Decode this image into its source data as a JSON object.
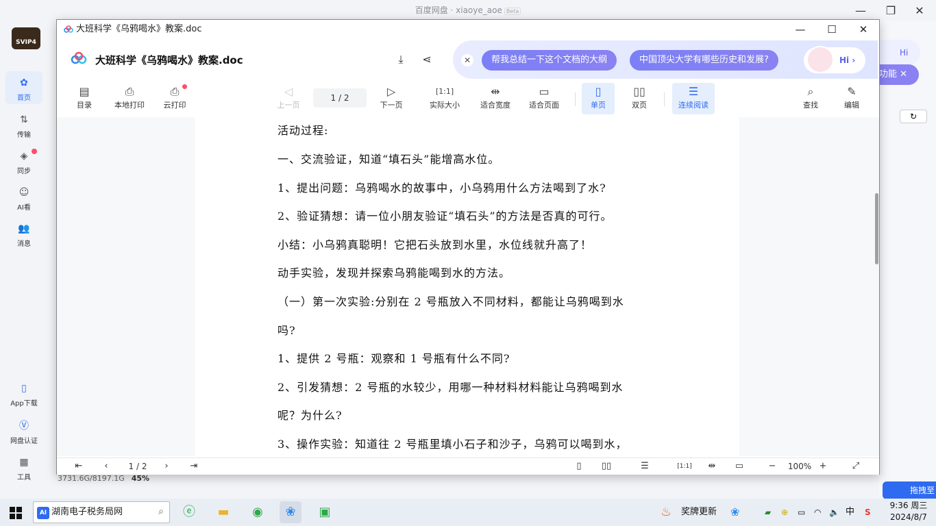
{
  "background": {
    "title": "百度网盘 · xiaoye_aoe",
    "beta": "Beta",
    "avatar_text": "SVIP4",
    "sidebar": [
      {
        "label": "首页",
        "icon": "home-icon"
      },
      {
        "label": "传输",
        "icon": "transfer-icon"
      },
      {
        "label": "同步",
        "icon": "sync-icon"
      },
      {
        "label": "AI看",
        "icon": "ai-view-icon"
      },
      {
        "label": "消息",
        "icon": "message-icon"
      },
      {
        "label": "App下载",
        "icon": "phone-icon"
      },
      {
        "label": "网盘认证",
        "icon": "verify-icon"
      },
      {
        "label": "工具",
        "icon": "tools-icon"
      }
    ],
    "storage_used": "3731.6G/8197.1G",
    "storage_percent": "45%",
    "right_feature": "功能",
    "right_hi": "Hi",
    "drag_label": "拖拽至"
  },
  "viewer": {
    "window_title": "大班科学《乌鸦喝水》教案.doc",
    "doc_title": "大班科学《乌鸦喝水》教案.doc",
    "ai": {
      "chip1": "帮我总结一下这个文档的大纲",
      "chip2": "中国顶尖大学有哪些历史和发展?",
      "hi": "Hi"
    },
    "toolbar": {
      "toc": "目录",
      "local_print": "本地打印",
      "cloud_print": "云打印",
      "prev_page": "上一页",
      "page_indicator": "1 / 2",
      "next_page": "下一页",
      "actual_size": "实际大小",
      "fit_width": "适合宽度",
      "fit_page": "适合页面",
      "single_page": "单页",
      "double_page": "双页",
      "continuous": "连续阅读",
      "find": "查找",
      "edit": "编辑"
    },
    "document_lines": [
      "活动过程:",
      "一、交流验证，知道“填石头”能增高水位。",
      "1、提出问题：乌鸦喝水的故事中，小乌鸦用什么方法喝到了水?",
      "2、验证猜想：请一位小朋友验证“填石头”的方法是否真的可行。",
      "小结：小乌鸦真聪明！它把石头放到水里，水位线就升高了！",
      "动手实验，发现并探索乌鸦能喝到水的方法。",
      "（一）第一次实验:分别在 2 号瓶放入不同材料，都能让乌鸦喝到水",
      "吗?",
      "1、提供 2 号瓶：观察和 1 号瓶有什么不同?",
      "2、引发猜想：2 号瓶的水较少，用哪一种材料材料能让乌鸦喝到水",
      "呢？为什么?",
      "3、操作实验：知道往 2 号瓶里填小石子和沙子，乌鸦可以喝到水，"
    ],
    "bottom": {
      "page_current": "1",
      "page_total": "/ 2",
      "zoom": "100%"
    }
  },
  "taskbar": {
    "search_text": "湖南电子税务局网",
    "search_ai": "AI",
    "notification": "奖牌更新",
    "ime": "中",
    "time": "9:36 周三",
    "date": "2024/8/7"
  }
}
